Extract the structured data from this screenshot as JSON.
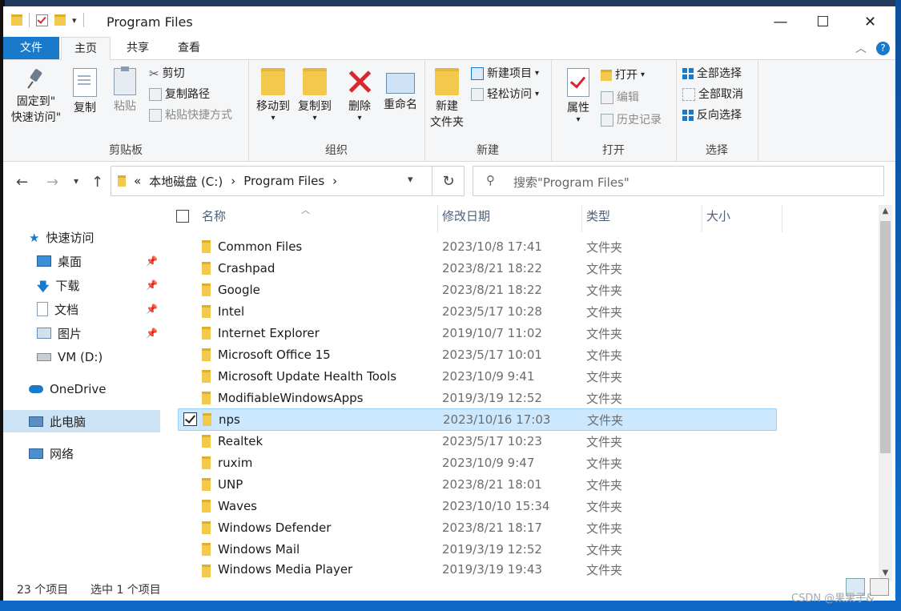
{
  "window": {
    "title": "Program Files",
    "controls": {
      "minimize": "—",
      "maximize": "☐",
      "close": "✕"
    }
  },
  "tabs": {
    "file": "文件",
    "home": "主页",
    "share": "共享",
    "view": "查看",
    "help_icon": "?",
    "collapse_icon": "︿"
  },
  "ribbon": {
    "clipboard": {
      "label": "剪贴板",
      "pin": "固定到\"快速访问\"",
      "pin_line1": "固定到\"",
      "pin_line2": "快速访问\"",
      "copy": "复制",
      "paste": "粘贴",
      "cut": "剪切",
      "copy_path": "复制路径",
      "paste_shortcut": "粘贴快捷方式"
    },
    "organize": {
      "label": "组织",
      "move_to": "移动到",
      "copy_to": "复制到",
      "delete": "删除",
      "rename": "重命名"
    },
    "new": {
      "label": "新建",
      "new_folder_line1": "新建",
      "new_folder_line2": "文件夹",
      "new_item": "新建项目",
      "easy_access": "轻松访问"
    },
    "open": {
      "label": "打开",
      "properties": "属性",
      "open": "打开",
      "edit": "编辑",
      "history": "历史记录"
    },
    "select": {
      "label": "选择",
      "select_all": "全部选择",
      "select_none": "全部取消",
      "invert": "反向选择"
    }
  },
  "address": {
    "prefix": "«",
    "crumbs": [
      "本地磁盘 (C:)",
      "Program Files"
    ],
    "separator": "›"
  },
  "search": {
    "placeholder": "搜索\"Program Files\""
  },
  "nav": {
    "quick_access": "快速访问",
    "items": [
      {
        "label": "桌面",
        "pinned": true
      },
      {
        "label": "下载",
        "pinned": true
      },
      {
        "label": "文档",
        "pinned": true
      },
      {
        "label": "图片",
        "pinned": true
      },
      {
        "label": "VM (D:)",
        "pinned": false
      }
    ],
    "onedrive": "OneDrive",
    "this_pc": "此电脑",
    "network": "网络"
  },
  "columns": {
    "name": "名称",
    "date": "修改日期",
    "type": "类型",
    "size": "大小"
  },
  "files": [
    {
      "name": "Common Files",
      "date": "2023/10/8 17:41",
      "type": "文件夹"
    },
    {
      "name": "Crashpad",
      "date": "2023/8/21 18:22",
      "type": "文件夹"
    },
    {
      "name": "Google",
      "date": "2023/8/21 18:22",
      "type": "文件夹"
    },
    {
      "name": "Intel",
      "date": "2023/5/17 10:28",
      "type": "文件夹"
    },
    {
      "name": "Internet Explorer",
      "date": "2019/10/7 11:02",
      "type": "文件夹"
    },
    {
      "name": "Microsoft Office 15",
      "date": "2023/5/17 10:01",
      "type": "文件夹"
    },
    {
      "name": "Microsoft Update Health Tools",
      "date": "2023/10/9 9:41",
      "type": "文件夹"
    },
    {
      "name": "ModifiableWindowsApps",
      "date": "2019/3/19 12:52",
      "type": "文件夹"
    },
    {
      "name": "nps",
      "date": "2023/10/16 17:03",
      "type": "文件夹",
      "selected": true
    },
    {
      "name": "Realtek",
      "date": "2023/5/17 10:23",
      "type": "文件夹"
    },
    {
      "name": "ruxim",
      "date": "2023/10/9 9:47",
      "type": "文件夹"
    },
    {
      "name": "UNP",
      "date": "2023/8/21 18:01",
      "type": "文件夹"
    },
    {
      "name": "Waves",
      "date": "2023/10/10 15:34",
      "type": "文件夹"
    },
    {
      "name": "Windows Defender",
      "date": "2023/8/21 18:17",
      "type": "文件夹"
    },
    {
      "name": "Windows Mail",
      "date": "2019/3/19 12:52",
      "type": "文件夹"
    },
    {
      "name": "Windows Media Player",
      "date": "2019/3/19 19:43",
      "type": "文件夹"
    }
  ],
  "status": {
    "count": "23 个项目",
    "selected": "选中 1 个项目"
  },
  "watermark": "CSDN @果果子&",
  "colors": {
    "accent": "#1979ca",
    "selection": "#cce8ff",
    "nav_selected": "#cce3f6"
  }
}
